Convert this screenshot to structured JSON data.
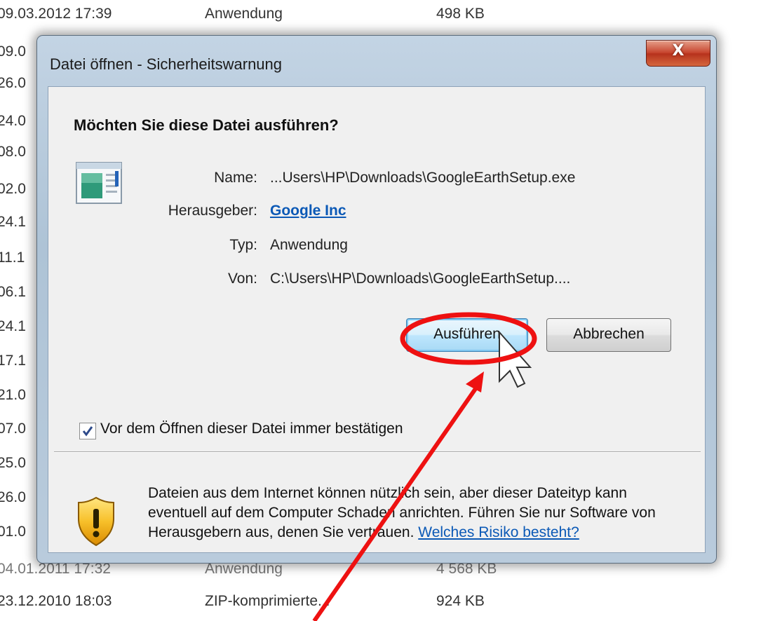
{
  "background_list": {
    "rows": [
      {
        "date": "09.03.2012 17:39",
        "type": "Anwendung",
        "size": "498 KB"
      },
      {
        "date": "09.0",
        "type": "",
        "size": ""
      },
      {
        "date": "26.0",
        "type": "",
        "size": ""
      },
      {
        "date": "24.0",
        "type": "",
        "size": ""
      },
      {
        "date": "08.0",
        "type": "",
        "size": ""
      },
      {
        "date": "02.0",
        "type": "",
        "size": ""
      },
      {
        "date": "24.1",
        "type": "",
        "size": ""
      },
      {
        "date": "11.1",
        "type": "",
        "size": ""
      },
      {
        "date": "06.1",
        "type": "",
        "size": ""
      },
      {
        "date": "24.1",
        "type": "",
        "size": ""
      },
      {
        "date": "17.1",
        "type": "",
        "size": ""
      },
      {
        "date": "21.0",
        "type": "",
        "size": ""
      },
      {
        "date": "07.0",
        "type": "",
        "size": ""
      },
      {
        "date": "25.0",
        "type": "",
        "size": ""
      },
      {
        "date": "26.0",
        "type": "",
        "size": ""
      },
      {
        "date": "01.0",
        "type": "",
        "size": ""
      },
      {
        "date": "04.01.2011 17:32",
        "type": "Anwendung",
        "size": "4 568 KB"
      },
      {
        "date": "23.12.2010 18:03",
        "type": "ZIP-komprimierte...",
        "size": "924 KB"
      }
    ]
  },
  "dialog": {
    "title": "Datei öffnen - Sicherheitswarnung",
    "close_label": "X",
    "question": "Möchten Sie diese Datei ausführen?",
    "fields": {
      "name_label": "Name:",
      "name_value": "...Users\\HP\\Downloads\\GoogleEarthSetup.exe",
      "publisher_label": "Herausgeber:",
      "publisher_value": "Google Inc",
      "type_label": "Typ:",
      "type_value": "Anwendung",
      "from_label": "Von:",
      "from_value": "C:\\Users\\HP\\Downloads\\GoogleEarthSetup...."
    },
    "run_button": "Ausführen",
    "cancel_button": "Abbrechen",
    "checkbox_label": "Vor dem Öffnen dieser Datei immer bestätigen",
    "checkbox_checked": true,
    "warning_text": "Dateien aus dem Internet können nützlich sein, aber dieser Dateityp kann eventuell auf dem Computer Schaden anrichten. Führen Sie nur Software von Herausgebern aus, denen Sie vertrauen. ",
    "warning_link": "Welches Risiko besteht?"
  },
  "colors": {
    "annotation_red": "#ee1111",
    "link_blue": "#0b59b6"
  },
  "icons": {
    "file": "application-file-icon",
    "warning": "shield-warning-icon",
    "cursor": "mouse-pointer-icon"
  }
}
